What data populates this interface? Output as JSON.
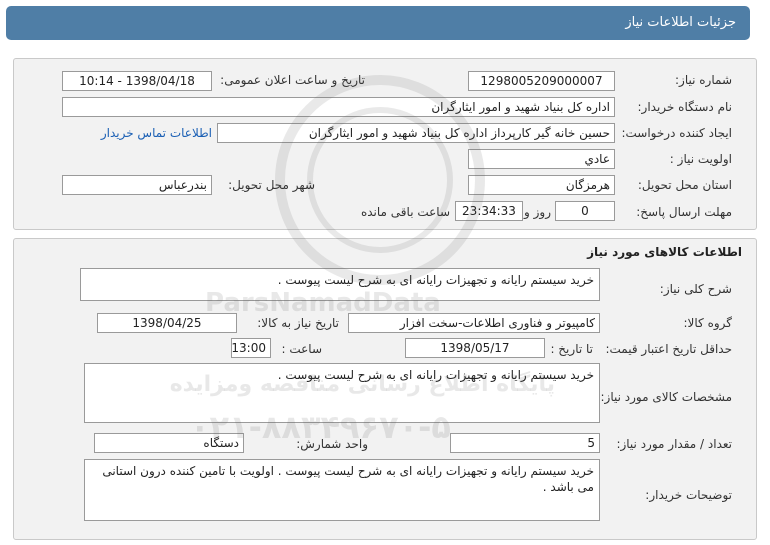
{
  "header": {
    "title": "جزئیات اطلاعات نیاز"
  },
  "info": {
    "need_number_label": "شماره نیاز:",
    "need_number": "1298005209000007",
    "announce_label": "تاریخ و ساعت اعلان عمومی:",
    "announce_value": "1398/04/18 - 10:14",
    "buyer_org_label": "نام دستگاه خریدار:",
    "buyer_org": "اداره کل بنیاد شهید و امور ایثارگران",
    "requester_label": "ایجاد کننده درخواست:",
    "requester": "حسین خانه گیر کارپرداز اداره کل بنیاد شهید و امور ایثارگران",
    "contact_link": "اطلاعات تماس خریدار",
    "priority_label": "اولویت نیاز :",
    "priority": "عادي",
    "province_label": "استان محل تحویل:",
    "province": "هرمزگان",
    "city_label": "شهر محل تحویل:",
    "city": "بندرعباس",
    "deadline_label": "مهلت ارسال پاسخ:",
    "deadline_days": "0",
    "day_and": "روز و",
    "deadline_time": "23:34:33",
    "remaining": "ساعت باقی مانده"
  },
  "goods": {
    "section_title": "اطلاعات کالاهای مورد نیاز",
    "general_desc_label": "شرح کلی نیاز:",
    "general_desc": "خرید سیستم رایانه و تجهیزات رایانه ای   به شرح لیست پیوست .",
    "group_label": "گروه کالا:",
    "group": "کامپیوتر و فناوری اطلاعات-سخت افزار",
    "need_date_label": "تاریخ نیاز به کالا:",
    "need_date": "1398/04/25",
    "validity_label": "حداقل تاریخ اعتبار قیمت:",
    "until_date_label": "تا تاریخ :",
    "validity_date": "1398/05/17",
    "hour_label": "ساعت :",
    "validity_hour": "13:00",
    "spec_label": "مشخصات کالای مورد نیاز:",
    "spec": "خرید سیستم رایانه و تجهیزات رایانه ای   به شرح لیست پیوست .",
    "qty_label": "تعداد / مقدار مورد نیاز:",
    "qty": "5",
    "unit_label": "واحد شمارش:",
    "unit": "دستگاه",
    "buyer_notes_label": "توضیحات خریدار:",
    "buyer_notes": "خرید سیستم رایانه و تجهیزات رایانه ای   به شرح لیست پیوست . اولویت با تامین کننده درون استانی می باشد ."
  },
  "watermark": {
    "line1": "ParsNamadData",
    "line2": "پایگاه اطلاع رسانی مناقصه ومزایده",
    "line3": "۰۲۱-۸۸۳۴۹۶۷۰-۵"
  },
  "colors": {
    "title_bg": "#4f7ea6",
    "link": "#1a5fb4",
    "panel_bg": "#f2f2f2"
  }
}
